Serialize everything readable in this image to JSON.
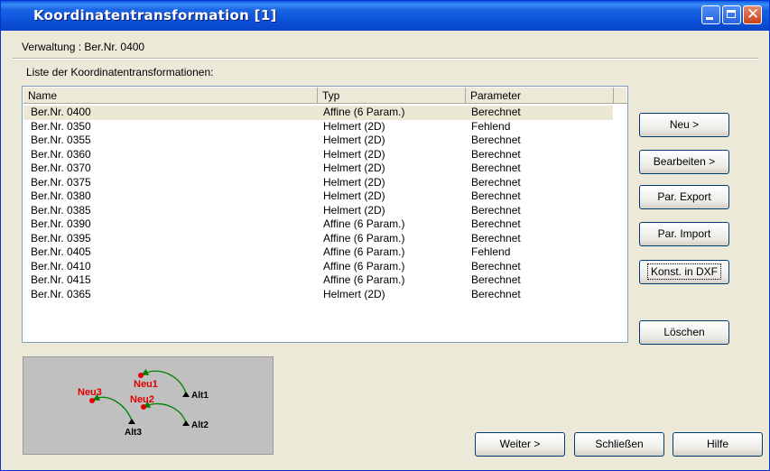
{
  "window": {
    "title": "Koordinatentransformation [1]"
  },
  "verwaltung_label": "Verwaltung : Ber.Nr. 0400",
  "list_title": "Liste der Koordinatentransformationen:",
  "columns": [
    "Name",
    "Typ",
    "Parameter"
  ],
  "rows": [
    {
      "name": "Ber.Nr. 0400",
      "typ": "Affine (6 Param.)",
      "param": "Berechnet",
      "selected": true
    },
    {
      "name": "Ber.Nr. 0350",
      "typ": "Helmert (2D)",
      "param": "Fehlend"
    },
    {
      "name": "Ber.Nr. 0355",
      "typ": "Helmert (2D)",
      "param": "Berechnet"
    },
    {
      "name": "Ber.Nr. 0360",
      "typ": "Helmert (2D)",
      "param": "Berechnet"
    },
    {
      "name": "Ber.Nr. 0370",
      "typ": "Helmert (2D)",
      "param": "Berechnet"
    },
    {
      "name": "Ber.Nr. 0375",
      "typ": "Helmert (2D)",
      "param": "Berechnet"
    },
    {
      "name": "Ber.Nr. 0380",
      "typ": "Helmert (2D)",
      "param": "Berechnet"
    },
    {
      "name": "Ber.Nr. 0385",
      "typ": "Helmert (2D)",
      "param": "Berechnet"
    },
    {
      "name": "Ber.Nr. 0390",
      "typ": "Affine (6 Param.)",
      "param": "Berechnet"
    },
    {
      "name": "Ber.Nr. 0395",
      "typ": "Affine (6 Param.)",
      "param": "Berechnet"
    },
    {
      "name": "Ber.Nr. 0405",
      "typ": "Affine (6 Param.)",
      "param": "Fehlend"
    },
    {
      "name": "Ber.Nr. 0410",
      "typ": "Affine (6 Param.)",
      "param": "Berechnet"
    },
    {
      "name": "Ber.Nr. 0415",
      "typ": "Affine (6 Param.)",
      "param": "Berechnet"
    },
    {
      "name": "Ber.Nr. 0365",
      "typ": "Helmert (2D)",
      "param": "Berechnet"
    }
  ],
  "buttons": {
    "neu": "Neu >",
    "bearbeiten": "Bearbeiten >",
    "par_export": "Par. Export",
    "par_import": "Par. Import",
    "konst_dxf": "Konst. in DXF",
    "loeschen": "Löschen",
    "weiter": "Weiter >",
    "schliessen": "Schließen",
    "hilfe": "Hilfe"
  },
  "diagram": {
    "labels": {
      "neu1": "Neu1",
      "neu2": "Neu2",
      "neu3": "Neu3",
      "alt1": "Alt1",
      "alt2": "Alt2",
      "alt3": "Alt3"
    },
    "colors": {
      "neu": "#e00000",
      "alt": "#000000",
      "arrow": "#008000"
    }
  }
}
